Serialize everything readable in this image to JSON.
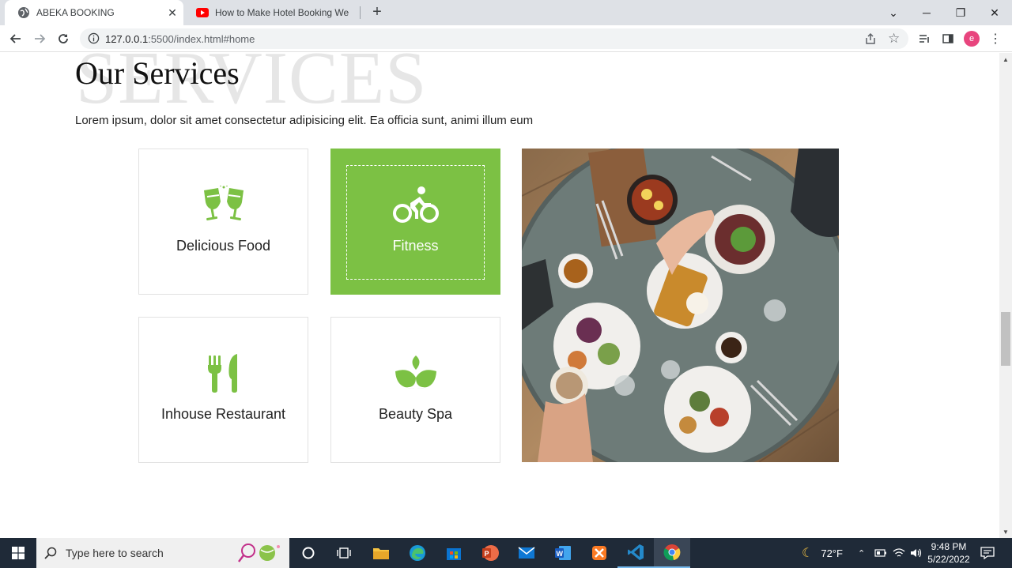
{
  "browser": {
    "tabs": [
      {
        "title": "ABEKA BOOKING",
        "active": true
      },
      {
        "title": "How to Make Hotel Booking We",
        "active": false
      }
    ],
    "new_tab_label": "+",
    "url_host": "127.0.0.1",
    "url_path": ":5500/index.html#home",
    "profile_initial": "e"
  },
  "services": {
    "bg_word": "SERVICES",
    "heading": "Our Services",
    "lead": "Lorem ipsum, dolor sit amet consectetur adipisicing elit. Ea officia sunt, animi illum eum",
    "cards": [
      {
        "label": "Delicious Food",
        "icon": "cheers-glasses-icon",
        "active": false
      },
      {
        "label": "Fitness",
        "icon": "bicycle-icon",
        "active": true
      },
      {
        "label": "Inhouse Restaurant",
        "icon": "fork-knife-icon",
        "active": false
      },
      {
        "label": "Beauty Spa",
        "icon": "lotus-leaf-icon",
        "active": false
      }
    ],
    "accent_color": "#7cc144"
  },
  "taskbar": {
    "search_placeholder": "Type here to search",
    "weather": "72°F",
    "time": "9:48 PM",
    "date": "5/22/2022"
  }
}
